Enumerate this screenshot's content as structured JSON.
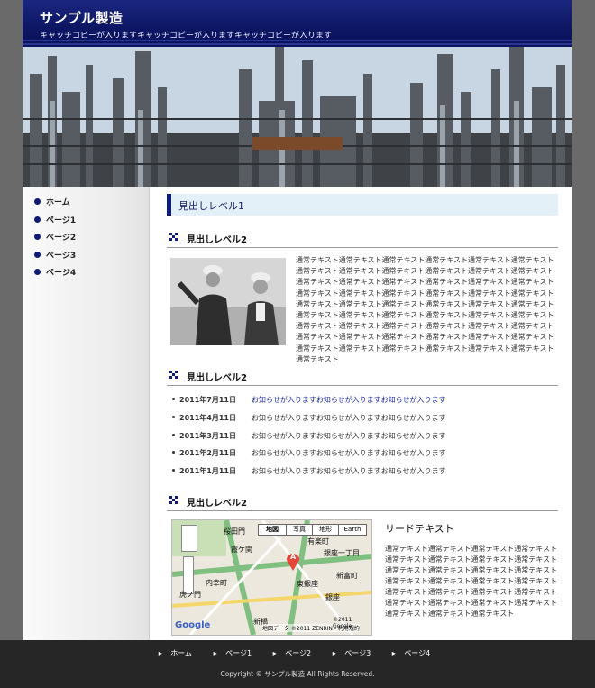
{
  "header": {
    "title": "サンプル製造",
    "catch": "キャッチコピーが入りますキャッチコピーが入りますキャッチコピーが入ります"
  },
  "sidebar": {
    "items": [
      {
        "label": "ホーム"
      },
      {
        "label": "ページ1"
      },
      {
        "label": "ページ2"
      },
      {
        "label": "ページ3"
      },
      {
        "label": "ページ4"
      }
    ]
  },
  "main": {
    "h1": "見出しレベル1",
    "section1": {
      "h2": "見出しレベル2",
      "text": "通常テキスト通常テキスト通常テキスト通常テキスト通常テキスト通常テキスト通常テキスト通常テキスト通常テキスト通常テキスト通常テキスト通常テキスト通常テキスト通常テキスト通常テキスト通常テキスト通常テキスト通常テキスト通常テキスト通常テキスト通常テキスト通常テキスト通常テキスト通常テキスト通常テキスト通常テキスト通常テキスト通常テキスト通常テキスト通常テキスト通常テキスト通常テキスト通常テキスト通常テキスト通常テキスト通常テキスト通常テキスト通常テキスト通常テキスト通常テキスト通常テキスト通常テキスト通常テキスト通常テキスト通常テキスト通常テキスト通常テキスト通常テキスト通常テキスト通常テキスト通常テキスト通常テキスト通常テキスト通常テキスト通常テキスト"
    },
    "section2": {
      "h2": "見出しレベル2",
      "news": [
        {
          "date": "2011年7月11日",
          "text": "お知らせが入りますお知らせが入りますお知らせが入ります"
        },
        {
          "date": "2011年4月11日",
          "text": "お知らせが入りますお知らせが入りますお知らせが入ります"
        },
        {
          "date": "2011年3月11日",
          "text": "お知らせが入りますお知らせが入りますお知らせが入ります"
        },
        {
          "date": "2011年2月11日",
          "text": "お知らせが入りますお知らせが入りますお知らせが入ります"
        },
        {
          "date": "2011年1月11日",
          "text": "お知らせが入りますお知らせが入りますお知らせが入ります"
        }
      ]
    },
    "section3": {
      "h2": "見出しレベル2",
      "lead": "リードテキスト",
      "text": "通常テキスト通常テキスト通常テキスト通常テキスト通常テキスト通常テキスト通常テキスト通常テキスト通常テキスト通常テキスト通常テキスト通常テキスト通常テキスト通常テキスト通常テキスト通常テキスト通常テキスト通常テキスト通常テキスト通常テキスト通常テキスト通常テキスト通常テキスト通常テキスト通常テキスト通常テキスト通常テキスト",
      "map": {
        "tabs": [
          "地図",
          "写真",
          "地形",
          "Earth"
        ],
        "labels": [
          "桜田門",
          "霞ケ関",
          "内幸町",
          "虎ノ門",
          "銀座一丁目",
          "新富町",
          "東銀座",
          "新橋",
          "有楽町",
          "銀座"
        ],
        "marker": "A",
        "logo": "Google",
        "attribution": "地図データ ©2011 ZENRIN - 利用規約",
        "copyright": "©2011 Google"
      }
    }
  },
  "footer": {
    "nav": [
      "ホーム",
      "ページ1",
      "ページ2",
      "ページ3",
      "ページ4"
    ],
    "copyright": "Copyright © サンプル製造 All Rights Reserved."
  },
  "colors": {
    "header": "#0d1663",
    "accent": "#0e1a8a",
    "footer": "#262626",
    "link": "#1b2aa8"
  }
}
